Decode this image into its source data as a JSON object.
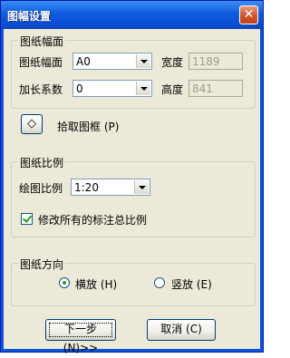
{
  "window": {
    "title": "图幅设置",
    "close_glyph": "✕"
  },
  "paper_size_group": {
    "title": "图纸幅面",
    "size_label": "图纸幅面",
    "size_value": "A0",
    "width_label": "宽度",
    "width_value": "1189",
    "extend_label": "加长系数",
    "extend_value": "0",
    "height_label": "高度",
    "height_value": "841"
  },
  "pick_frame": {
    "icon": "diamond-icon",
    "glyph": "◇",
    "label": "拾取图框 (P)"
  },
  "scale_group": {
    "title": "图纸比例",
    "scale_label": "绘图比例",
    "scale_value": "1:20",
    "modify_all_label": "修改所有的标注总比例",
    "modify_all_checked": true
  },
  "orientation_group": {
    "title": "图纸方向",
    "landscape_label": "横放 (H)",
    "portrait_label": "竖放 (E)",
    "selected": "landscape"
  },
  "buttons": {
    "next_label": "下一步 (N)>>",
    "cancel_label": "取消 (C)"
  },
  "colors": {
    "titlebar": "#0a55e0",
    "client": "#ece9d8",
    "check": "#21a121"
  }
}
